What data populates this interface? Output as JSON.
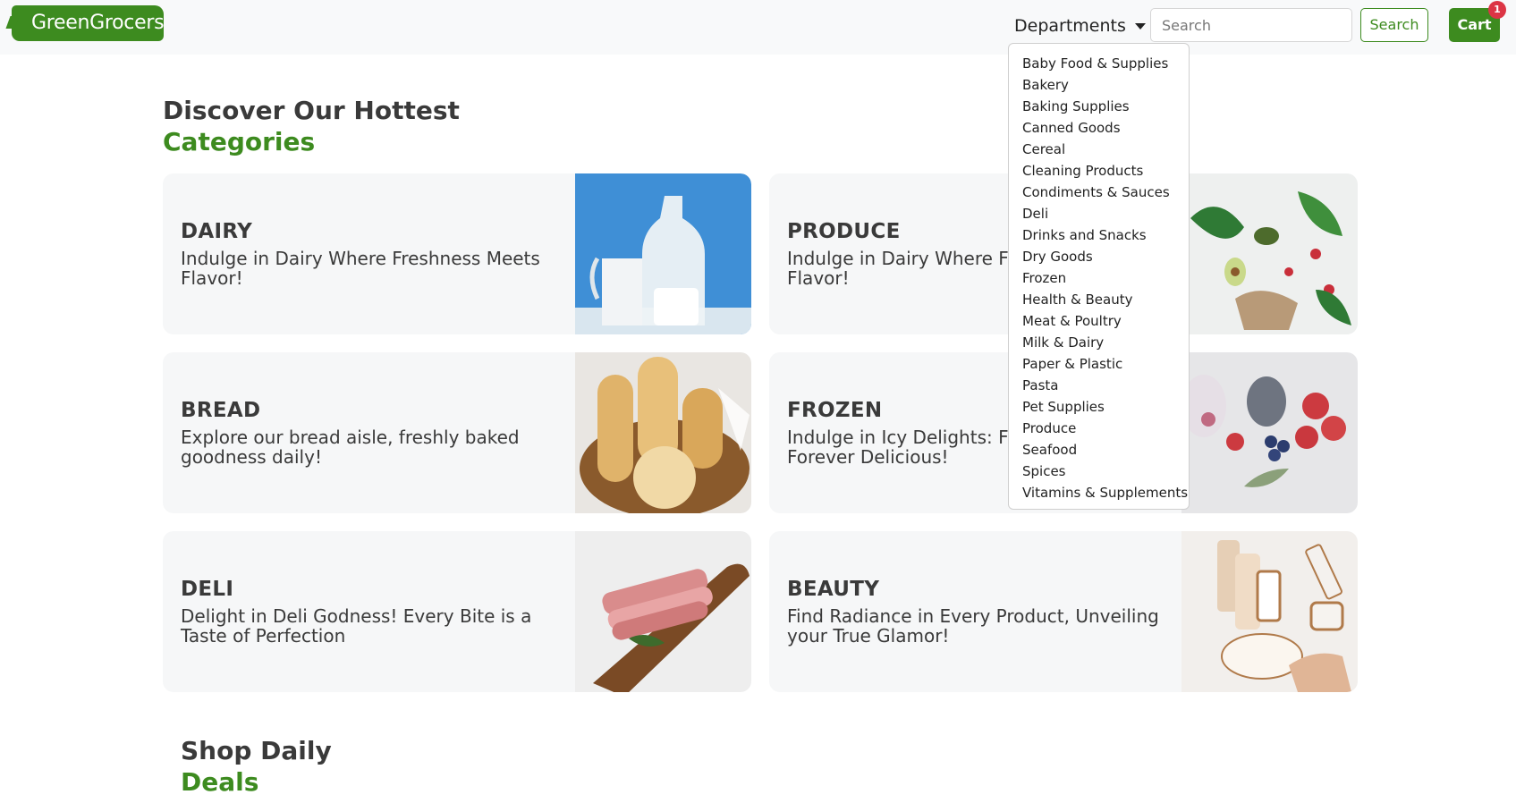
{
  "nav": {
    "logo": "GreenGrocers",
    "departments_label": "Departments",
    "search_placeholder": "Search",
    "search_button": "Search",
    "cart_label": "Cart",
    "cart_count": "1"
  },
  "departments": [
    "Baby Food & Supplies",
    "Bakery",
    "Baking Supplies",
    "Canned Goods",
    "Cereal",
    "Cleaning Products",
    "Condiments & Sauces",
    "Deli",
    "Drinks and Snacks",
    "Dry Goods",
    "Frozen",
    "Health & Beauty",
    "Meat & Poultry",
    "Milk & Dairy",
    "Paper & Plastic",
    "Pasta",
    "Pet Supplies",
    "Produce",
    "Seafood",
    "Spices",
    "Vitamins & Supplements"
  ],
  "categories_heading": {
    "line1": "Discover Our Hottest",
    "line2": "Categories"
  },
  "cards": [
    {
      "title": "DAIRY",
      "desc": "Indulge in Dairy Where Freshness Meets Flavor!",
      "image": "milk-bottles-image"
    },
    {
      "title": "PRODUCE",
      "desc": "Indulge in Dairy Where Freshness Meets Flavor!",
      "image": "vegetables-image"
    },
    {
      "title": "BREAD",
      "desc": "Explore our bread aisle, freshly baked goodness daily!",
      "image": "bread-basket-image"
    },
    {
      "title": "FROZEN",
      "desc": "Indulge in Icy Delights: Freshly Frozen, Forever Delicious!",
      "image": "frozen-berries-image"
    },
    {
      "title": "DELI",
      "desc": "Delight in Deli Godness! Every Bite is a Taste of Perfection",
      "image": "bacon-board-image"
    },
    {
      "title": "BEAUTY",
      "desc": "Find Radiance in Every Product, Unveiling your True Glamor!",
      "image": "beauty-products-image"
    }
  ],
  "deals_heading": {
    "line1": "Shop Daily",
    "line2": "Deals"
  },
  "colors": {
    "brand_green": "#3d8b1f",
    "badge_red": "#dc3545",
    "card_bg": "#f6f7f8"
  }
}
